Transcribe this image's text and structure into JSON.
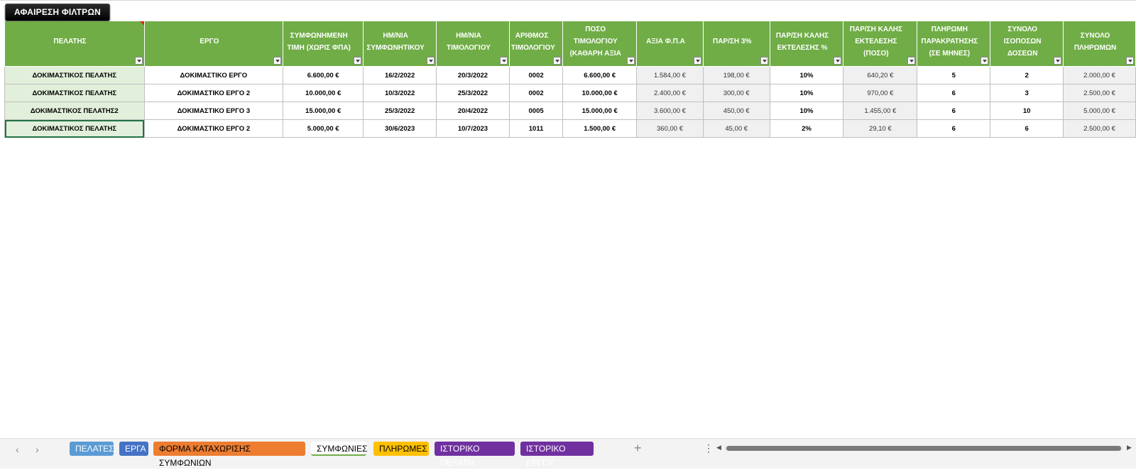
{
  "toolbar": {
    "remove_filters_label": "ΑΦΑΙΡΕΣΗ ΦΙΛΤΡΩΝ"
  },
  "table": {
    "columns": [
      "ΠΕΛΑΤΗΣ",
      "ΕΡΓΟ",
      "ΣΥΜΦΩΝΗΜΕΝΗ ΤΙΜΗ (ΧΩΡΙΣ ΦΠΑ)",
      "ΗΜ/ΝΙΑ ΣΥΜΦΩΝΗΤΙΚΟΥ",
      "ΗΜ/ΝΙΑ ΤΙΜΟΛΟΓΙΟΥ",
      "ΑΡΙΘΜΟΣ ΤΙΜΟΛΟΓΙΟΥ",
      "ΠΟΣΟ ΤΙΜΟΛΟΓΙΟΥ (ΚΑΘΑΡΗ ΑΞΙΑ",
      "ΑΞΙΑ Φ.Π.Α",
      "ΠΑΡ/ΣΗ 3%",
      "ΠΑΡ/ΣΗ ΚΑΛΗΣ ΕΚΤΕΛΕΣΗΣ %",
      "ΠΑΡ/ΣΗ ΚΑΛΗΣ ΕΚΤΕΛΕΣΗΣ (ΠΟΣΟ)",
      "ΠΛΗΡΩΜΗ ΠΑΡΑΚΡΑΤΗΣΗΣ (ΣΕ ΜΗΝΕΣ)",
      "ΣΥΝΟΛΟ ΙΣΟΠΟΣΩΝ ΔΟΣΕΩΝ",
      "ΣΥΝΟΛΟ ΠΛΗΡΩΜΩΝ"
    ],
    "rows": [
      [
        "ΔΟΚΙΜΑΣΤΙΚΟΣ ΠΕΛΑΤΗΣ",
        "ΔΟΚΙΜΑΣΤΙΚΟ ΕΡΓΟ",
        "6.600,00 €",
        "16/2/2022",
        "20/3/2022",
        "0002",
        "6.600,00 €",
        "1.584,00 €",
        "198,00 €",
        "10%",
        "640,20 €",
        "5",
        "2",
        "2.000,00 €"
      ],
      [
        "ΔΟΚΙΜΑΣΤΙΚΟΣ ΠΕΛΑΤΗΣ",
        "ΔΟΚΙΜΑΣΤΙΚΟ ΕΡΓΟ 2",
        "10.000,00 €",
        "10/3/2022",
        "25/3/2022",
        "0002",
        "10.000,00 €",
        "2.400,00 €",
        "300,00 €",
        "10%",
        "970,00 €",
        "6",
        "3",
        "2.500,00 €"
      ],
      [
        "ΔΟΚΙΜΑΣΤΙΚΟΣ ΠΕΛΑΤΗΣ2",
        "ΔΟΚΙΜΑΣΤΙΚΟ ΕΡΓΟ 3",
        "15.000,00 €",
        "25/3/2022",
        "20/4/2022",
        "0005",
        "15.000,00 €",
        "3.600,00 €",
        "450,00 €",
        "10%",
        "1.455,00 €",
        "6",
        "10",
        "5.000,00 €"
      ],
      [
        "ΔΟΚΙΜΑΣΤΙΚΟΣ ΠΕΛΑΤΗΣ",
        "ΔΟΚΙΜΑΣΤΙΚΟ ΕΡΓΟ 2",
        "5.000,00 €",
        "30/6/2023",
        "10/7/2023",
        "1011",
        "1.500,00 €",
        "360,00 €",
        "45,00 €",
        "2%",
        "29,10 €",
        "6",
        "6",
        "2.500,00 €"
      ]
    ]
  },
  "sheet_tabs": [
    {
      "label": "ΠΕΛΑΤΕΣ",
      "color": "#5b9bd5",
      "active": false
    },
    {
      "label": "ΕΡΓΑ",
      "color": "#4472c4",
      "active": false
    },
    {
      "label": "ΦΟΡΜΑ ΚΑΤΑΧΩΡΙΣΗΣ ΣΥΜΦΩΝΙΩΝ",
      "color": "#ed7d31",
      "active": false
    },
    {
      "label": "ΣΥΜΦΩΝΙΕΣ",
      "color": "#70ad47",
      "active": true
    },
    {
      "label": "ΠΛΗΡΩΜΕΣ",
      "color": "#ffc000",
      "active": false
    },
    {
      "label": "ΙΣΤΟΡΙΚΟ ΠΕΛΑΤΗ",
      "color": "#7030a0",
      "active": false
    },
    {
      "label": "ΙΣΤΟΡΙΚΟ ΕΡΓΟΥ",
      "color": "#7030a0",
      "active": false
    }
  ],
  "icons": {
    "prev": "‹",
    "next": "›",
    "add": "+",
    "more": "⋮",
    "scroll_left": "◀",
    "scroll_right": "▶"
  }
}
